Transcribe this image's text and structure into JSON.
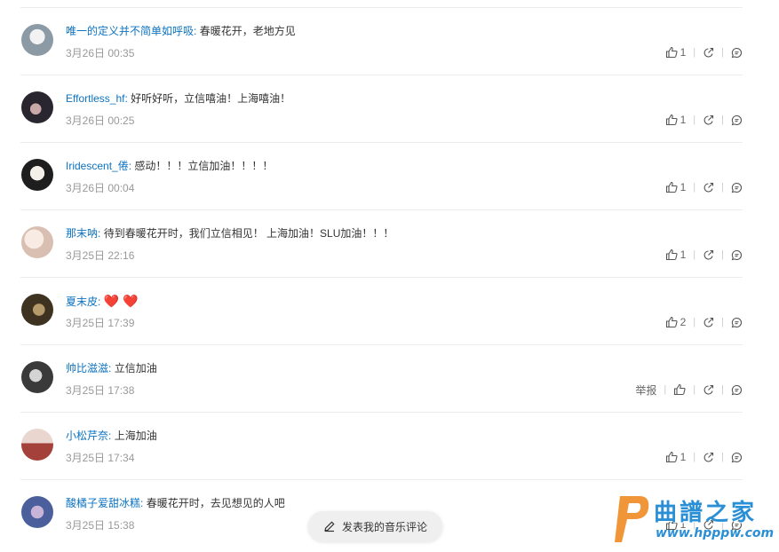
{
  "comments": [
    {
      "user": "唯一的定义并不简单如呼吸:",
      "content": "春暖花开，老地方见",
      "time": "3月26日 00:35",
      "likes": "1",
      "avatar_color": "#7a8a9a"
    },
    {
      "user": "Effortless_hf:",
      "content": "好听好听，立信嘻油！上海嘻油！",
      "time": "3月26日 00:25",
      "likes": "1",
      "avatar_color": "#2a2630"
    },
    {
      "user": "Iridescent_倦:",
      "content": "感动！！！立信加油！！！！",
      "time": "3月26日 00:04",
      "likes": "1",
      "avatar_color": "#d8d2cf"
    },
    {
      "user": "那末呐:",
      "content": "待到春暖花开时，我们立信相见！ 上海加油！SLU加油！！！",
      "time": "3月25日 22:16",
      "likes": "1",
      "avatar_color": "#e6d2c8"
    },
    {
      "user": "夏末皮:",
      "content": "",
      "time": "3月25日 17:39",
      "likes": "2",
      "hearts": "❤️ ❤️",
      "avatar_color": "#5a4a2c"
    },
    {
      "user": "帅比滋滋:",
      "content": "立信加油",
      "time": "3月25日 17:38",
      "likes": "",
      "report": "举报",
      "avatar_color": "#6e6e6e"
    },
    {
      "user": "小松芹奈:",
      "content": "上海加油",
      "time": "3月25日 17:34",
      "likes": "1",
      "avatar_color": "#c28a7e"
    },
    {
      "user": "酸橘子爱甜冰糕:",
      "content": "春暖花开时，去见想见的人吧",
      "time": "3月25日 15:38",
      "likes": "1",
      "avatar_color": "#5a6ea8"
    }
  ],
  "fab_label": "发表我的音乐评论",
  "watermark": {
    "title": "曲譜之家",
    "url": "www.hpppw.com"
  },
  "colors": {
    "username": "#0c73c2",
    "time": "#999999",
    "border": "#ececec"
  }
}
